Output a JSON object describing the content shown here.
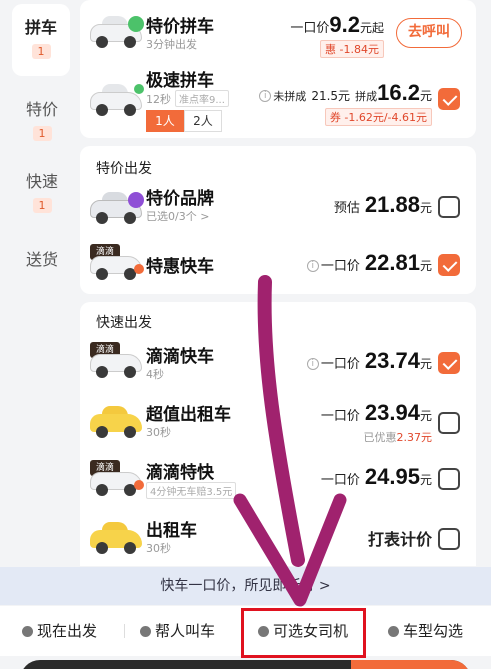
{
  "nav": [
    {
      "label": "拼车",
      "badge": "1"
    },
    {
      "label": "特价",
      "badge": "1"
    },
    {
      "label": "快速",
      "badge": "1"
    },
    {
      "label": "送货",
      "badge": ""
    }
  ],
  "carpool": {
    "special": {
      "title": "特价拼车",
      "sub": "3分钟出发",
      "price_label": "一口价",
      "price": "9.2",
      "price_unit": "元起",
      "discount": "惠 -1.84元",
      "call_label": "去呼叫"
    },
    "express": {
      "title": "极速拼车",
      "sub": "12秒",
      "sub_tag": "准点率9...",
      "fail_label": "未拼成",
      "fail_price": "21.5元",
      "success_label": "拼成",
      "price": "16.2",
      "price_unit": "元",
      "discount": "券 -1.62元/-4.61元",
      "seat_options": [
        "1人",
        "2人"
      ]
    }
  },
  "special_section": {
    "title": "特价出发",
    "brand": {
      "title": "特价品牌",
      "sub": "已选0/3个 >",
      "price_label": "预估",
      "price": "21.88",
      "price_unit": "元"
    },
    "discount_express": {
      "title": "特惠快车",
      "price_label": "一口价",
      "price": "22.81",
      "price_unit": "元"
    }
  },
  "fast_section": {
    "title": "快速出发",
    "didi_express": {
      "title": "滴滴快车",
      "sub": "4秒",
      "price_label": "一口价",
      "price": "23.74",
      "price_unit": "元"
    },
    "value_taxi": {
      "title": "超值出租车",
      "sub": "30秒",
      "price_label": "一口价",
      "price": "23.94",
      "price_unit": "元",
      "saved": "已优惠",
      "saved_amount": "2.37元"
    },
    "didi_special": {
      "title": "滴滴特快",
      "sub_tag": "4分钟无车赔3.5元",
      "price_label": "一口价",
      "price": "24.95",
      "price_unit": "元"
    },
    "taxi": {
      "title": "出租车",
      "sub": "30秒",
      "price_text": "打表计价"
    }
  },
  "didi_tag": "滴滴",
  "banner": "快车一口价，所见即所付 >",
  "toolbar": {
    "now": "现在出发",
    "help": "帮人叫车",
    "female": "可选女司机",
    "type": "车型勾选"
  },
  "colors": {
    "accent": "#f26b3a",
    "highlight": "#e0121f",
    "arrow": "#a0226e"
  }
}
